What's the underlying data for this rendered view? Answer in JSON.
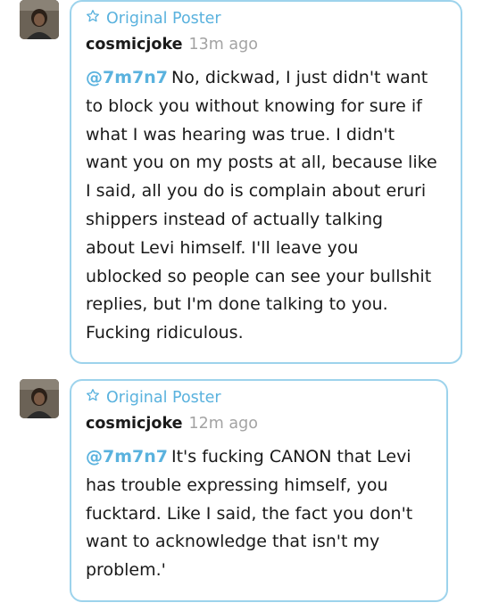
{
  "colors": {
    "accent": "#5ab2de",
    "bubble_border": "#9dd3ec",
    "timestamp": "#a3a3a3",
    "text": "#1a1a1a"
  },
  "replies": [
    {
      "avatar_icon": "user-avatar",
      "badge_icon": "star-outline-icon",
      "badge_label": "Original Poster",
      "author": "cosmicjoke",
      "timestamp": "13m ago",
      "mention": "@7m7n7",
      "text": "No, dickwad, I just didn't want\nto block you without knowing for sure if\nwhat I was hearing was true.  I didn't\nwant you on my posts at all, because like\nI said, all you do is complain about eruri\nshippers instead of actually talking\nabout Levi himself.  I'll leave you\nublocked so people can see your bullshit\nreplies, but I'm done talking to you.\nFucking ridiculous."
    },
    {
      "avatar_icon": "user-avatar",
      "badge_icon": "star-outline-icon",
      "badge_label": "Original Poster",
      "author": "cosmicjoke",
      "timestamp": "12m ago",
      "mention": "@7m7n7",
      "text": "It's fucking CANON that Levi\nhas trouble expressing himself, you\nfucktard.  Like I said, the fact you don't\nwant to acknowledge that isn't my\nproblem.'"
    }
  ]
}
